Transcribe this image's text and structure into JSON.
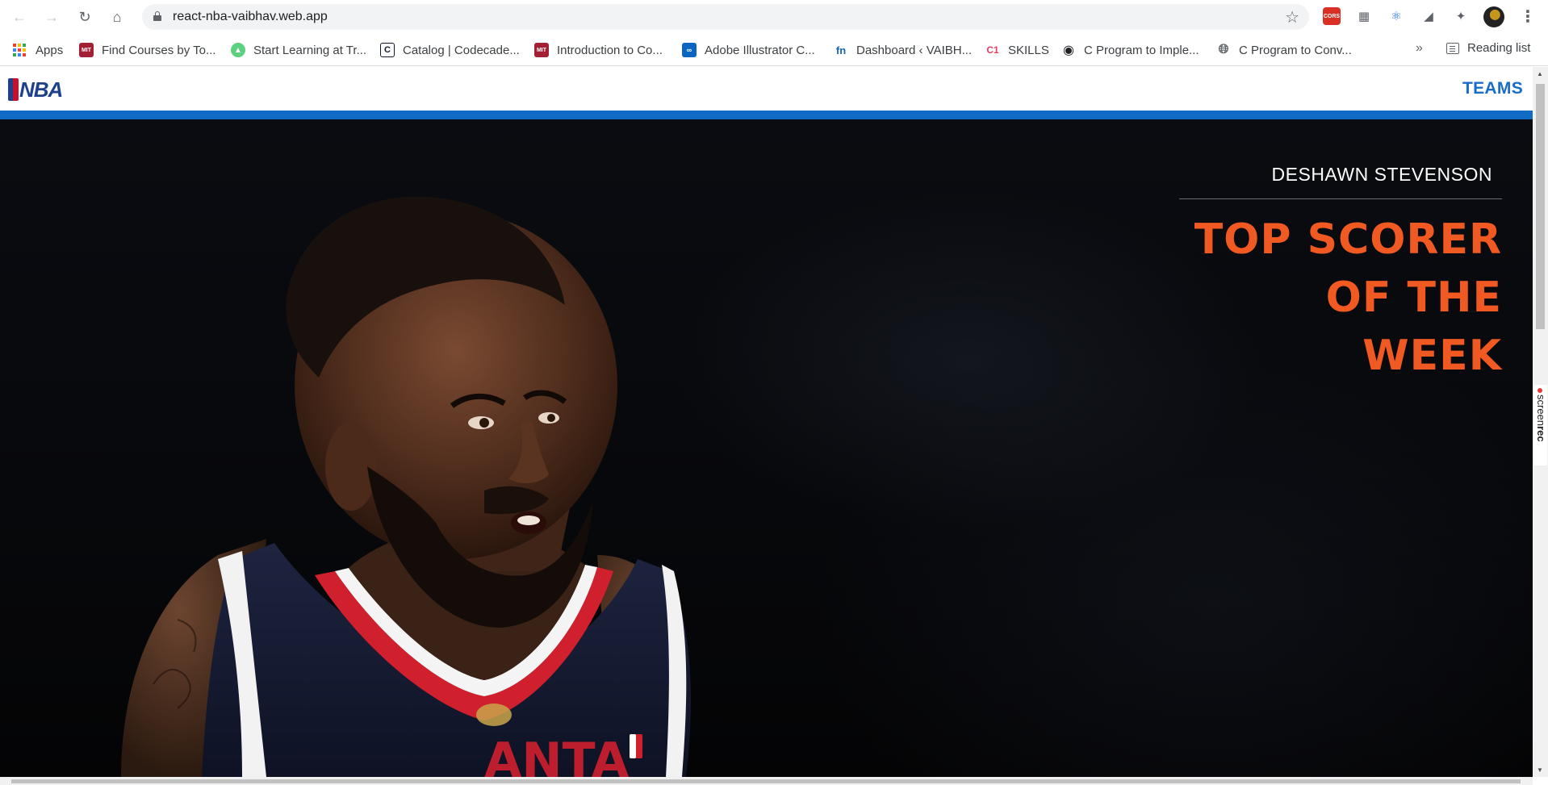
{
  "browser": {
    "url": "react-nba-vaibhav.web.app",
    "extensions": [
      "cors-extension-icon",
      "code-extension-icon",
      "react-devtools-icon",
      "analytics-extension-icon",
      "puzzle-icon"
    ],
    "bookmarks": [
      {
        "label": "Apps",
        "icon": "apps-grid-icon"
      },
      {
        "label": "Find Courses by To...",
        "icon": "mit-ocw-icon"
      },
      {
        "label": "Start Learning at Tr...",
        "icon": "treehouse-icon"
      },
      {
        "label": "Catalog | Codecade...",
        "icon": "codecademy-icon"
      },
      {
        "label": "Introduction to Co...",
        "icon": "mit-ocw-icon"
      },
      {
        "label": "Adobe Illustrator C...",
        "icon": "adobe-course-icon"
      },
      {
        "label": "Dashboard ‹ VAIBH...",
        "icon": "fn-icon"
      },
      {
        "label": "SKILLS",
        "icon": "c1-icon"
      },
      {
        "label": "C Program to Imple...",
        "icon": "circle-icon"
      },
      {
        "label": "C Program to Conv...",
        "icon": "globe-icon"
      }
    ],
    "reading_list": "Reading list",
    "accent_red": "#d93025"
  },
  "site": {
    "logo_text": "NBA",
    "nav": {
      "teams_label": "TEAMS"
    },
    "brand_blue": "#0f6bc4"
  },
  "hero": {
    "player_name": "DESHAWN STEVENSON",
    "title_line_1": "TOP SCORER",
    "title_line_2": "OF THE WEEK",
    "title_color": "#f05a22"
  },
  "overlay": {
    "screenrec_prefix": "screen",
    "screenrec_suffix": "rec"
  }
}
